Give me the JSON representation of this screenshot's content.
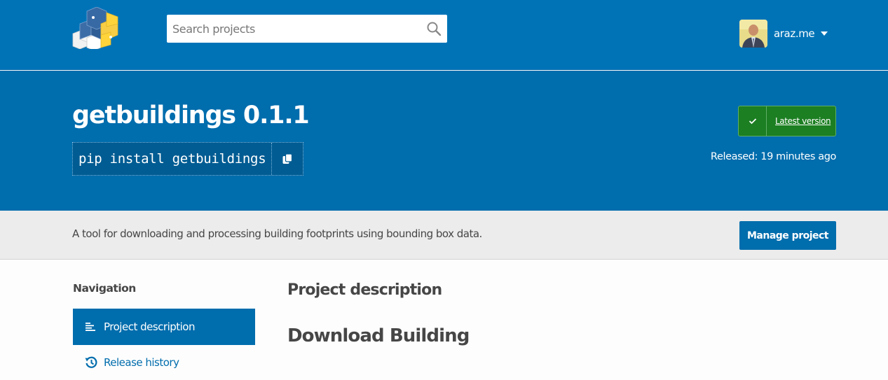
{
  "header": {
    "logo_alt": "PyPI",
    "search": {
      "placeholder": "Search projects",
      "value": ""
    },
    "user": {
      "name": "araz.me"
    }
  },
  "package": {
    "title": "getbuildings 0.1.1",
    "install_command": "pip install getbuildings",
    "latest_label": "Latest version",
    "released": "Released: 19 minutes ago"
  },
  "summary": {
    "text": "A tool for downloading and processing building footprints using bounding box data.",
    "manage_label": "Manage project"
  },
  "navigation": {
    "heading": "Navigation",
    "items": [
      {
        "label": "Project description",
        "icon": "align-left-icon",
        "active": true
      },
      {
        "label": "Release history",
        "icon": "history-icon",
        "active": false
      }
    ]
  },
  "content": {
    "section_heading": "Project description",
    "readme_heading": "Download Building"
  },
  "colors": {
    "brand_blue": "#0073b7",
    "hero_blue": "#006dad",
    "success_green": "#1c7f22",
    "summary_bg": "#ececec"
  }
}
